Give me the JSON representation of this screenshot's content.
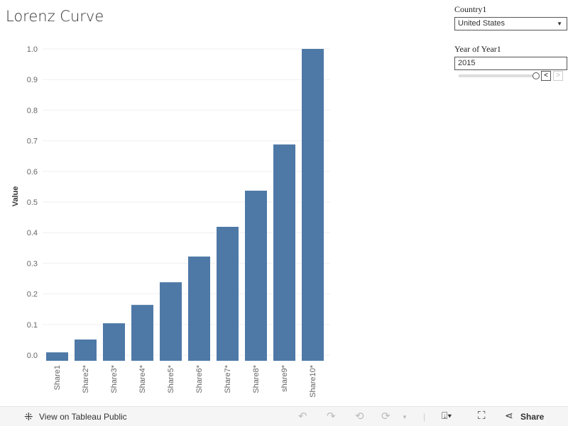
{
  "title": "Lorenz Curve",
  "controls": {
    "country_label": "Country1",
    "country_value": "United States",
    "year_label": "Year of Year1",
    "year_value": "2015",
    "slider_position": 1.0
  },
  "footer": {
    "view_label": "View on Tableau Public",
    "share_label": "Share"
  },
  "chart_data": {
    "type": "bar",
    "title": "Lorenz Curve",
    "xlabel": "",
    "ylabel": "Value",
    "categories": [
      "Share1",
      "Share2*",
      "Share3*",
      "Share4*",
      "Share5*",
      "Share6*",
      "Share7*",
      "Share8*",
      "share9*",
      "Share10*"
    ],
    "values": [
      0.009,
      0.051,
      0.104,
      0.164,
      0.238,
      0.322,
      0.419,
      0.537,
      0.688,
      1.0
    ],
    "ylim": [
      0,
      1.0
    ],
    "yticks": [
      "0.0",
      "0.1",
      "0.2",
      "0.3",
      "0.4",
      "0.5",
      "0.6",
      "0.7",
      "0.8",
      "0.9",
      "1.0"
    ],
    "grid": true,
    "color": "#4e79a7"
  }
}
